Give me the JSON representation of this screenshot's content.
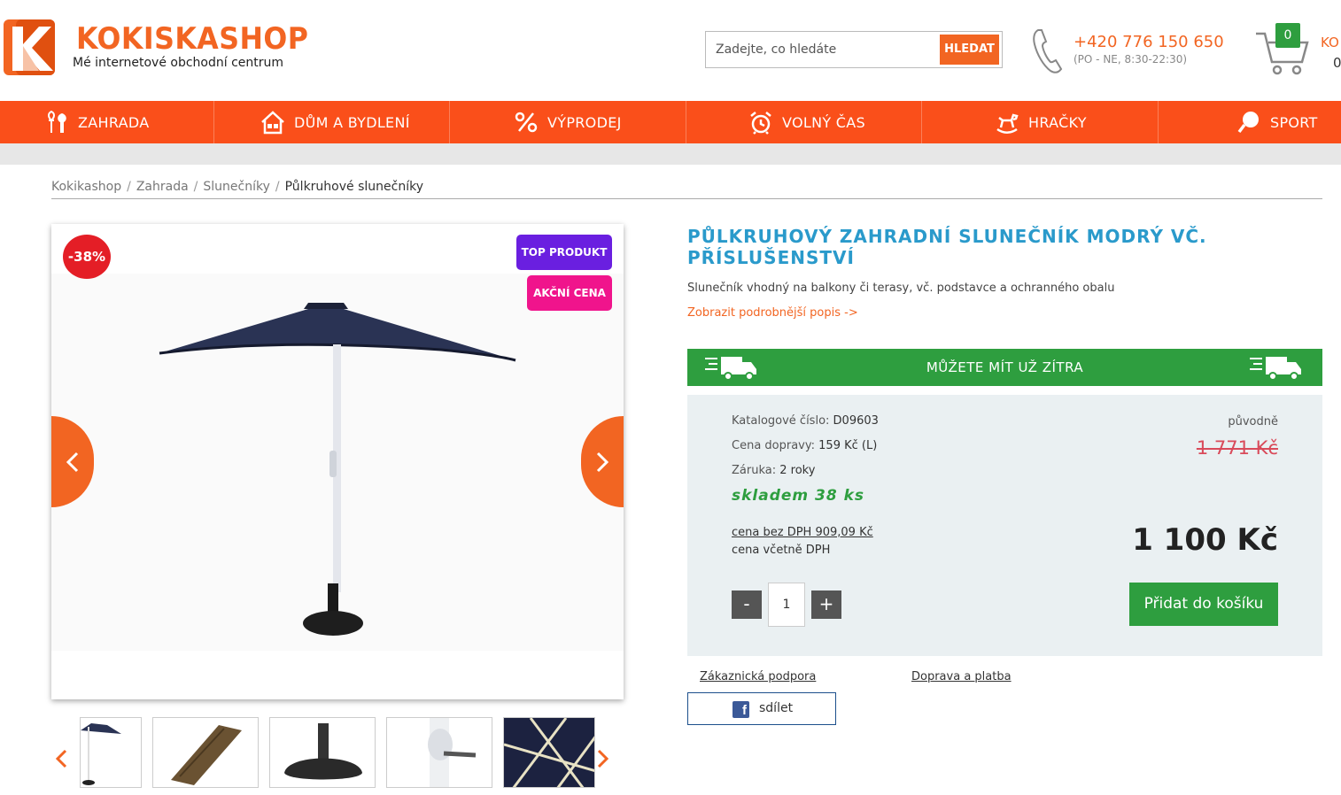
{
  "header": {
    "logo_name": "KOKISKASHOP",
    "logo_tagline": "Mé internetové obchodní centrum",
    "search_placeholder": "Zadejte, co hledáte",
    "search_button": "HLEDAT",
    "phone": "+420 776 150 650",
    "phone_hours": "(PO - NE, 8:30-22:30)",
    "cart_badge": "0",
    "cart_label": "KO",
    "cart_count": "0"
  },
  "nav": [
    {
      "label": "ZAHRADA",
      "icon": "garden-icon"
    },
    {
      "label": "DŮM A BYDLENÍ",
      "icon": "house-icon"
    },
    {
      "label": "VÝPRODEJ",
      "icon": "percent-icon"
    },
    {
      "label": "VOLNÝ ČAS",
      "icon": "alarm-clock-icon"
    },
    {
      "label": "HRAČKY",
      "icon": "rocking-horse-icon"
    },
    {
      "label": "SPORT",
      "icon": "sport-icon"
    }
  ],
  "breadcrumb": [
    "Kokikashop",
    "Zahrada",
    "Slunečníky",
    "Půlkruhové slunečníky"
  ],
  "gallery": {
    "discount": "-38%",
    "badge_top": "TOP PRODUKT",
    "badge_action": "AKČNÍ CENA"
  },
  "product": {
    "title": "PŮLKRUHOVÝ ZAHRADNÍ SLUNEČNÍK MODRÝ VČ. PŘÍSLUŠENSTVÍ",
    "description": "Slunečník vhodný na balkony či terasy, vč. podstavce a ochranného obalu",
    "more_link": "Zobrazit podrobnější popis ->",
    "delivery": "MŮŽETE MÍT UŽ ZÍTRA",
    "catalog_label": "Katalogové číslo:",
    "catalog_value": "D09603",
    "shipping_label": "Cena dopravy:",
    "shipping_value": "159 Kč (L)",
    "warranty_label": "Záruka:",
    "warranty_value": "2 roky",
    "stock": "skladem 38 ks",
    "price_no_vat": "cena bez DPH 909,09 Kč",
    "price_vat_label": "cena včetně DPH",
    "original_label": "původně",
    "original_price": "1 771 Kč",
    "price": "1 100 Kč",
    "qty_minus": "-",
    "qty_value": "1",
    "qty_plus": "+",
    "add_to_cart": "Přidat do košíku"
  },
  "links": {
    "support": "Zákaznická podpora",
    "shipping": "Doprava a platba",
    "share": "sdílet"
  },
  "colors": {
    "brand_orange": "#f26522",
    "nav_orange": "#fa4f1a",
    "green": "#2e9e3f",
    "title_blue": "#2a9acb"
  }
}
